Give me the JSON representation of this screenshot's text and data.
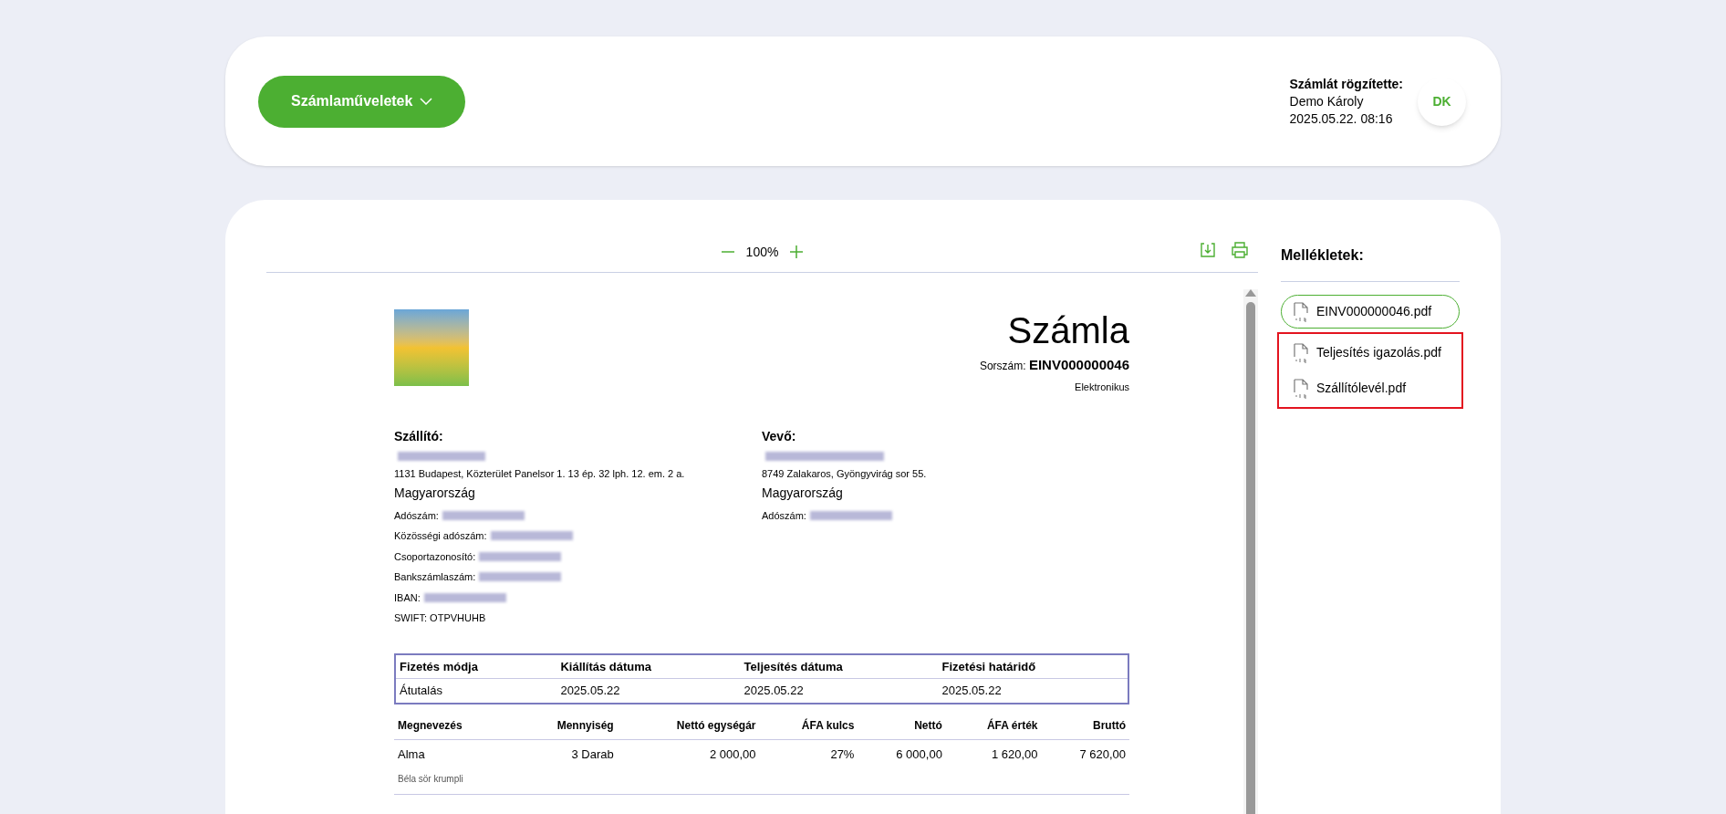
{
  "header": {
    "actions_button": "Számlaműveletek",
    "recorded_by_label": "Számlát rögzítette:",
    "recorded_by_name": "Demo Károly",
    "recorded_at": "2025.05.22. 08:16",
    "avatar_initials": "DK"
  },
  "viewer": {
    "zoom": "100%"
  },
  "invoice": {
    "title": "Számla",
    "serial_label": "Sorszám:",
    "serial": "EINV000000046",
    "type": "Elektronikus",
    "seller": {
      "heading": "Szállító:",
      "address": "1131 Budapest, Közterület Panelsor 1. 13 ép. 32 lph. 12. em. 2 a.",
      "country": "Magyarország",
      "fields": [
        "Adószám:",
        "Közösségi adószám:",
        "Csoportazonosító:",
        "Bankszámlaszám:",
        "IBAN:"
      ],
      "swift": "SWIFT: OTPVHUHB"
    },
    "buyer": {
      "heading": "Vevő:",
      "address": "8749 Zalakaros, Gyöngyvirág sor 55.",
      "country": "Magyarország",
      "fields": [
        "Adószám:"
      ]
    },
    "payment": {
      "columns": [
        "Fizetés módja",
        "Kiállítás dátuma",
        "Teljesítés dátuma",
        "Fizetési határidő"
      ],
      "values": [
        "Átutalás",
        "2025.05.22",
        "2025.05.22",
        "2025.05.22"
      ]
    },
    "items": {
      "columns": [
        "Megnevezés",
        "Mennyiség",
        "Nettó egységár",
        "ÁFA kulcs",
        "Nettó",
        "ÁFA érték",
        "Bruttó"
      ],
      "rows": [
        {
          "cells": [
            "Alma",
            "3 Darab",
            "2 000,00",
            "27%",
            "6 000,00",
            "1 620,00",
            "7 620,00"
          ],
          "note": "Béla sör krumpli"
        }
      ]
    }
  },
  "attachments": {
    "title": "Mellékletek:",
    "items": [
      {
        "name": "EINV000000046.pdf",
        "selected": true,
        "highlighted": false
      },
      {
        "name": "Teljesítés igazolás.pdf",
        "selected": false,
        "highlighted": true
      },
      {
        "name": "Szállítólevél.pdf",
        "selected": false,
        "highlighted": true
      }
    ]
  }
}
